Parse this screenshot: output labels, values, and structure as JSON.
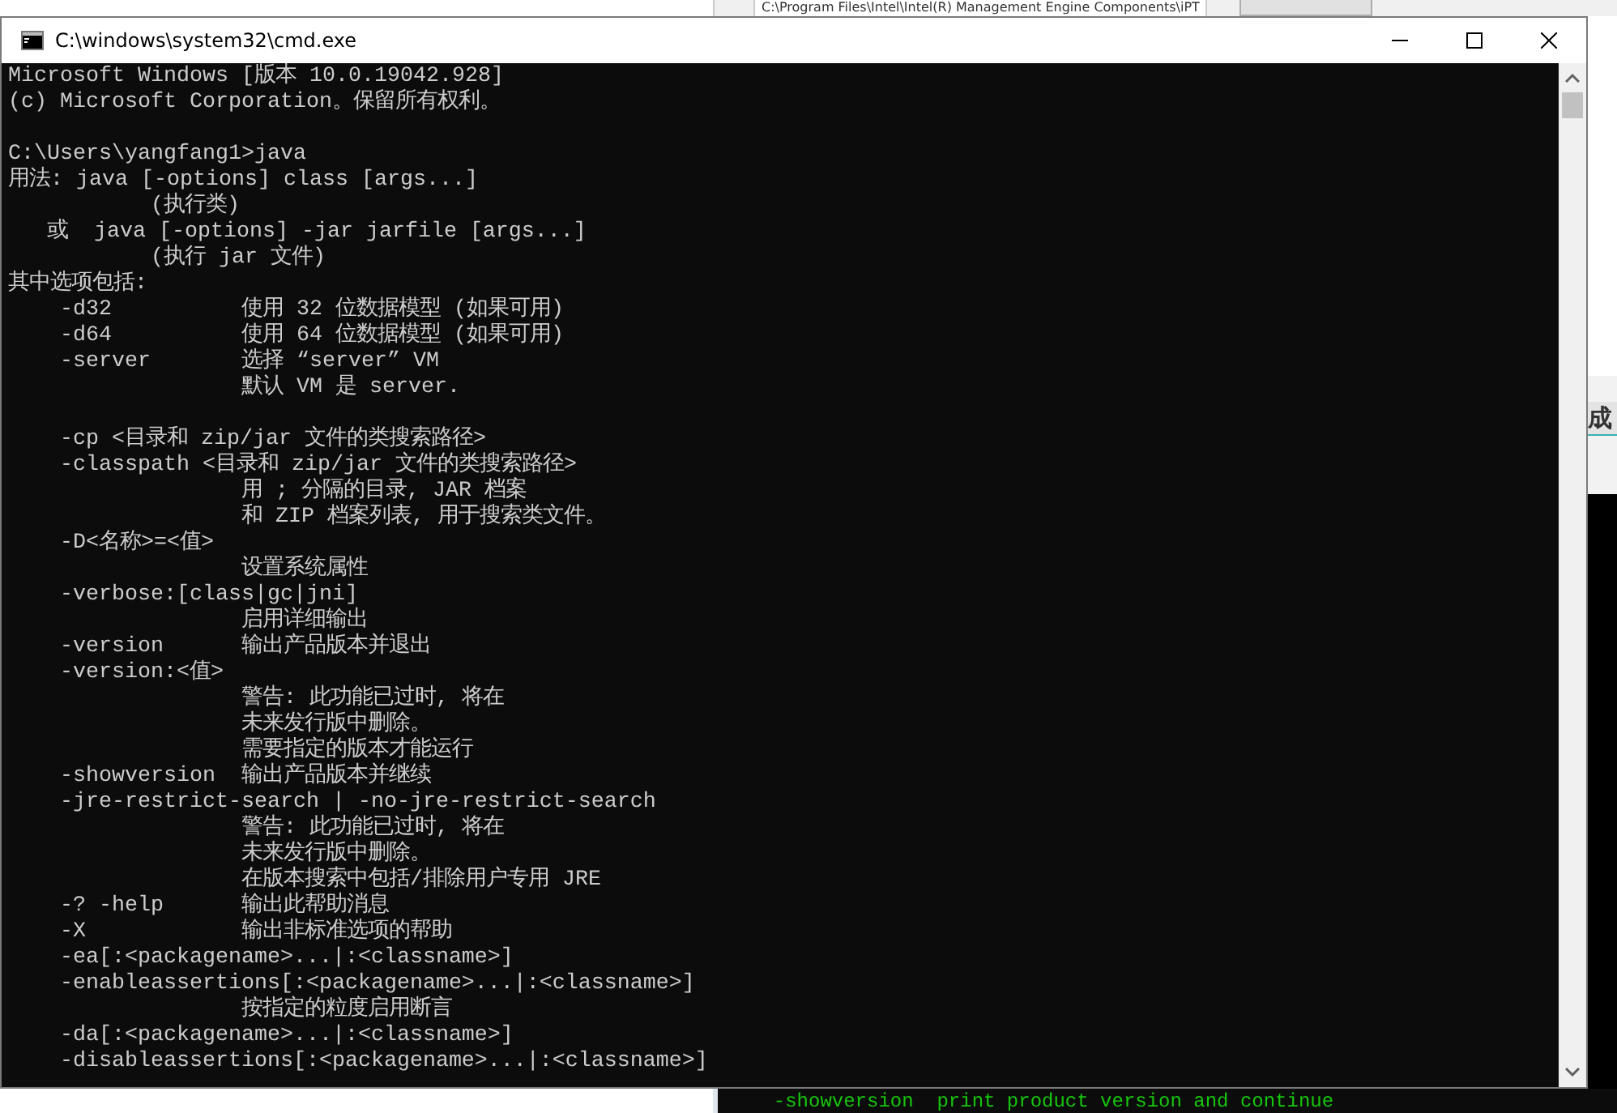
{
  "background_window": {
    "title": "C:\\Program Files\\Intel\\Intel(R) Management Engine Components\\iPT"
  },
  "side_panel": {
    "label": "成"
  },
  "background_terminal": {
    "line": "  -showversion  print product version and continue"
  },
  "window": {
    "title": "C:\\windows\\system32\\cmd.exe"
  },
  "console": {
    "lines": [
      {
        "kind": "text",
        "text": "Microsoft Windows [版本 10.0.19042.928]"
      },
      {
        "kind": "text",
        "text": "(c) Microsoft Corporation。保留所有权利。"
      },
      {
        "kind": "blank"
      },
      {
        "kind": "text",
        "text": "C:\\Users\\yangfang1>java"
      },
      {
        "kind": "text",
        "text": "用法: java [-options] class [args...]"
      },
      {
        "kind": "text",
        "text": "           (执行类)"
      },
      {
        "kind": "text",
        "text": "   或  java [-options] -jar jarfile [args...]"
      },
      {
        "kind": "text",
        "text": "           (执行 jar 文件)"
      },
      {
        "kind": "text",
        "text": "其中选项包括:"
      },
      {
        "kind": "text",
        "text": "    -d32          使用 32 位数据模型 (如果可用)"
      },
      {
        "kind": "text",
        "text": "    -d64          使用 64 位数据模型 (如果可用)"
      },
      {
        "kind": "text",
        "text": "    -server       选择 “server” VM"
      },
      {
        "kind": "text",
        "text": "                  默认 VM 是 server."
      },
      {
        "kind": "blank"
      },
      {
        "kind": "text",
        "text": "    -cp <目录和 zip/jar 文件的类搜索路径>"
      },
      {
        "kind": "text",
        "text": "    -classpath <目录和 zip/jar 文件的类搜索路径>"
      },
      {
        "kind": "text",
        "text": "                  用 ; 分隔的目录, JAR 档案"
      },
      {
        "kind": "text",
        "text": "                  和 ZIP 档案列表, 用于搜索类文件。"
      },
      {
        "kind": "text",
        "text": "    -D<名称>=<值>"
      },
      {
        "kind": "text",
        "text": "                  设置系统属性"
      },
      {
        "kind": "text",
        "text": "    -verbose:[class|gc|jni]"
      },
      {
        "kind": "text",
        "text": "                  启用详细输出"
      },
      {
        "kind": "text",
        "text": "    -version      输出产品版本并退出"
      },
      {
        "kind": "text",
        "text": "    -version:<值>"
      },
      {
        "kind": "text",
        "text": "                  警告: 此功能已过时, 将在"
      },
      {
        "kind": "text",
        "text": "                  未来发行版中删除。"
      },
      {
        "kind": "text",
        "text": "                  需要指定的版本才能运行"
      },
      {
        "kind": "text",
        "text": "    -showversion  输出产品版本并继续"
      },
      {
        "kind": "text",
        "text": "    -jre-restrict-search | -no-jre-restrict-search"
      },
      {
        "kind": "text",
        "text": "                  警告: 此功能已过时, 将在"
      },
      {
        "kind": "text",
        "text": "                  未来发行版中删除。"
      },
      {
        "kind": "text",
        "text": "                  在版本搜索中包括/排除用户专用 JRE"
      },
      {
        "kind": "text",
        "text": "    -? -help      输出此帮助消息"
      },
      {
        "kind": "text",
        "text": "    -X            输出非标准选项的帮助"
      },
      {
        "kind": "text",
        "text": "    -ea[:<packagename>...|:<classname>]"
      },
      {
        "kind": "text",
        "text": "    -enableassertions[:<packagename>...|:<classname>]"
      },
      {
        "kind": "text",
        "text": "                  按指定的粒度启用断言"
      },
      {
        "kind": "text",
        "text": "    -da[:<packagename>...|:<classname>]"
      },
      {
        "kind": "text",
        "text": "    -disableassertions[:<packagename>...|:<classname>]"
      }
    ]
  }
}
